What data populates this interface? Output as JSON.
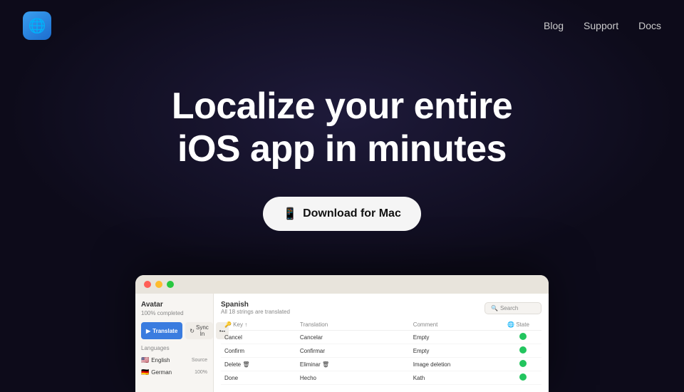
{
  "nav": {
    "logo_icon": "🌐",
    "links": [
      {
        "label": "Blog",
        "id": "blog"
      },
      {
        "label": "Support",
        "id": "support"
      },
      {
        "label": "Docs",
        "id": "docs"
      }
    ]
  },
  "hero": {
    "title_line1": "Localize your entire",
    "title_line2": "iOS app in minutes",
    "cta_label": "Download for Mac",
    "cta_icon": "📱"
  },
  "app_preview": {
    "sidebar": {
      "project_name": "Avatar",
      "progress": "100% completed",
      "btn_translate": "Translate",
      "btn_sync": "Sync In",
      "languages_label": "Languages",
      "languages": [
        {
          "flag": "🇺🇸",
          "name": "English",
          "badge": "Source"
        },
        {
          "flag": "🇩🇪",
          "name": "German",
          "badge": "100%"
        }
      ]
    },
    "main": {
      "section_title": "Spanish",
      "section_subtitle": "All 18 strings are translated",
      "search_placeholder": "Search",
      "columns": [
        "🔑 Key ↑",
        "Translation",
        "Comment",
        "🌐 State"
      ],
      "rows": [
        {
          "key": "Cancel",
          "translation": "Cancelar",
          "comment": "Empty",
          "state": "green"
        },
        {
          "key": "Confirm",
          "translation": "Confirmar",
          "comment": "Empty",
          "state": "green"
        },
        {
          "key": "Delete 🗑",
          "translation": "Eliminar 🗑",
          "comment": "Image deletion",
          "state": "green"
        },
        {
          "key": "Done",
          "translation": "Hecho",
          "comment": "Kath",
          "state": "green"
        }
      ]
    }
  }
}
